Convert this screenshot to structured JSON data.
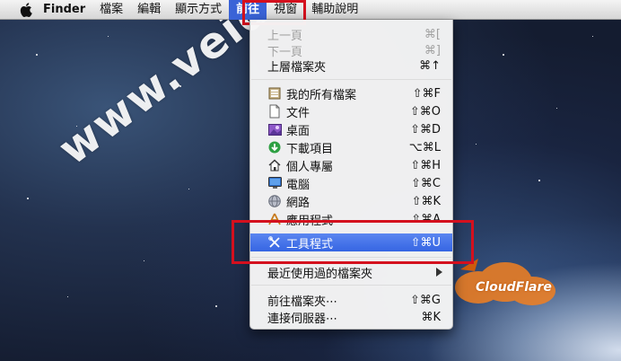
{
  "menubar": {
    "items": [
      {
        "label": "Finder",
        "bold": true
      },
      {
        "label": "檔案"
      },
      {
        "label": "編輯"
      },
      {
        "label": "顯示方式"
      },
      {
        "label": "前往",
        "active": true
      },
      {
        "label": "視窗"
      },
      {
        "label": "輔助說明"
      }
    ]
  },
  "go_menu": {
    "back": {
      "label": "上一頁",
      "shortcut": "⌘["
    },
    "forward": {
      "label": "下一頁",
      "shortcut": "⌘]"
    },
    "enclosing": {
      "label": "上層檔案夾",
      "shortcut": "⌘↑"
    },
    "all_files": {
      "label": "我的所有檔案",
      "shortcut": "⇧⌘F",
      "icon": "all-my-files-icon"
    },
    "documents": {
      "label": "文件",
      "shortcut": "⇧⌘O",
      "icon": "documents-icon"
    },
    "desktop": {
      "label": "桌面",
      "shortcut": "⇧⌘D",
      "icon": "desktop-icon"
    },
    "downloads": {
      "label": "下載項目",
      "shortcut": "⌥⌘L",
      "icon": "downloads-icon"
    },
    "home": {
      "label": "個人專屬",
      "shortcut": "⇧⌘H",
      "icon": "home-icon"
    },
    "computer": {
      "label": "電腦",
      "shortcut": "⇧⌘C",
      "icon": "computer-icon"
    },
    "network": {
      "label": "網路",
      "shortcut": "⇧⌘K",
      "icon": "network-icon"
    },
    "applications": {
      "label": "應用程式",
      "shortcut": "⇧⌘A",
      "icon": "applications-icon"
    },
    "utilities": {
      "label": "工具程式",
      "shortcut": "⇧⌘U",
      "icon": "utilities-icon"
    },
    "recent_folders": {
      "label": "最近使用過的檔案夾"
    },
    "go_to_folder": {
      "label": "前往檔案夾⋯",
      "shortcut": "⇧⌘G"
    },
    "connect_server": {
      "label": "連接伺服器⋯",
      "shortcut": "⌘K"
    }
  },
  "watermark": {
    "text": "www.veidc.com"
  },
  "cloudflare": {
    "text": "CloudFlare"
  },
  "colors": {
    "selection": "#3565e3",
    "highlight_box": "#d4101e"
  }
}
